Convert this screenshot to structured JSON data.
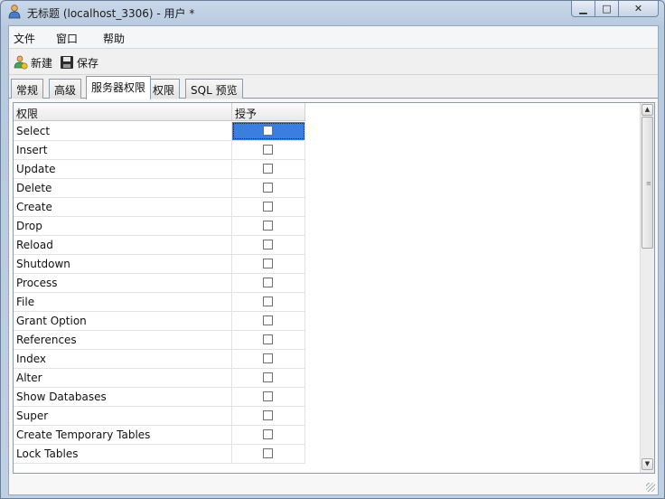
{
  "window": {
    "title": "无标题 (localhost_3306) - 用户 *",
    "controls": {
      "minimize": "▁",
      "maximize": "□",
      "close": "✕"
    }
  },
  "menu": [
    "文件",
    "窗口",
    "帮助"
  ],
  "toolbar": {
    "new_label": "新建",
    "save_label": "保存"
  },
  "tabs": [
    "常规",
    "高级",
    "服务器权限",
    "权限",
    "SQL 预览"
  ],
  "active_tab": "服务器权限",
  "grid": {
    "columns": {
      "privilege": "权限",
      "grant": "授予"
    },
    "rows": [
      {
        "name": "Select",
        "granted": false
      },
      {
        "name": "Insert",
        "granted": false
      },
      {
        "name": "Update",
        "granted": false
      },
      {
        "name": "Delete",
        "granted": false
      },
      {
        "name": "Create",
        "granted": false
      },
      {
        "name": "Drop",
        "granted": false
      },
      {
        "name": "Reload",
        "granted": false
      },
      {
        "name": "Shutdown",
        "granted": false
      },
      {
        "name": "Process",
        "granted": false
      },
      {
        "name": "File",
        "granted": false
      },
      {
        "name": "Grant Option",
        "granted": false
      },
      {
        "name": "References",
        "granted": false
      },
      {
        "name": "Index",
        "granted": false
      },
      {
        "name": "Alter",
        "granted": false
      },
      {
        "name": "Show Databases",
        "granted": false
      },
      {
        "name": "Super",
        "granted": false
      },
      {
        "name": "Create Temporary Tables",
        "granted": false
      },
      {
        "name": "Lock Tables",
        "granted": false
      }
    ]
  },
  "scrollbar": {
    "up": "▲",
    "down": "▼",
    "grip": "≡"
  },
  "colors": {
    "selection": "#3a7ee0",
    "window_frame": "#b7c9de"
  },
  "icons": {
    "app": "user-database-icon",
    "new": "new-user-icon",
    "save": "floppy-disk-icon"
  }
}
